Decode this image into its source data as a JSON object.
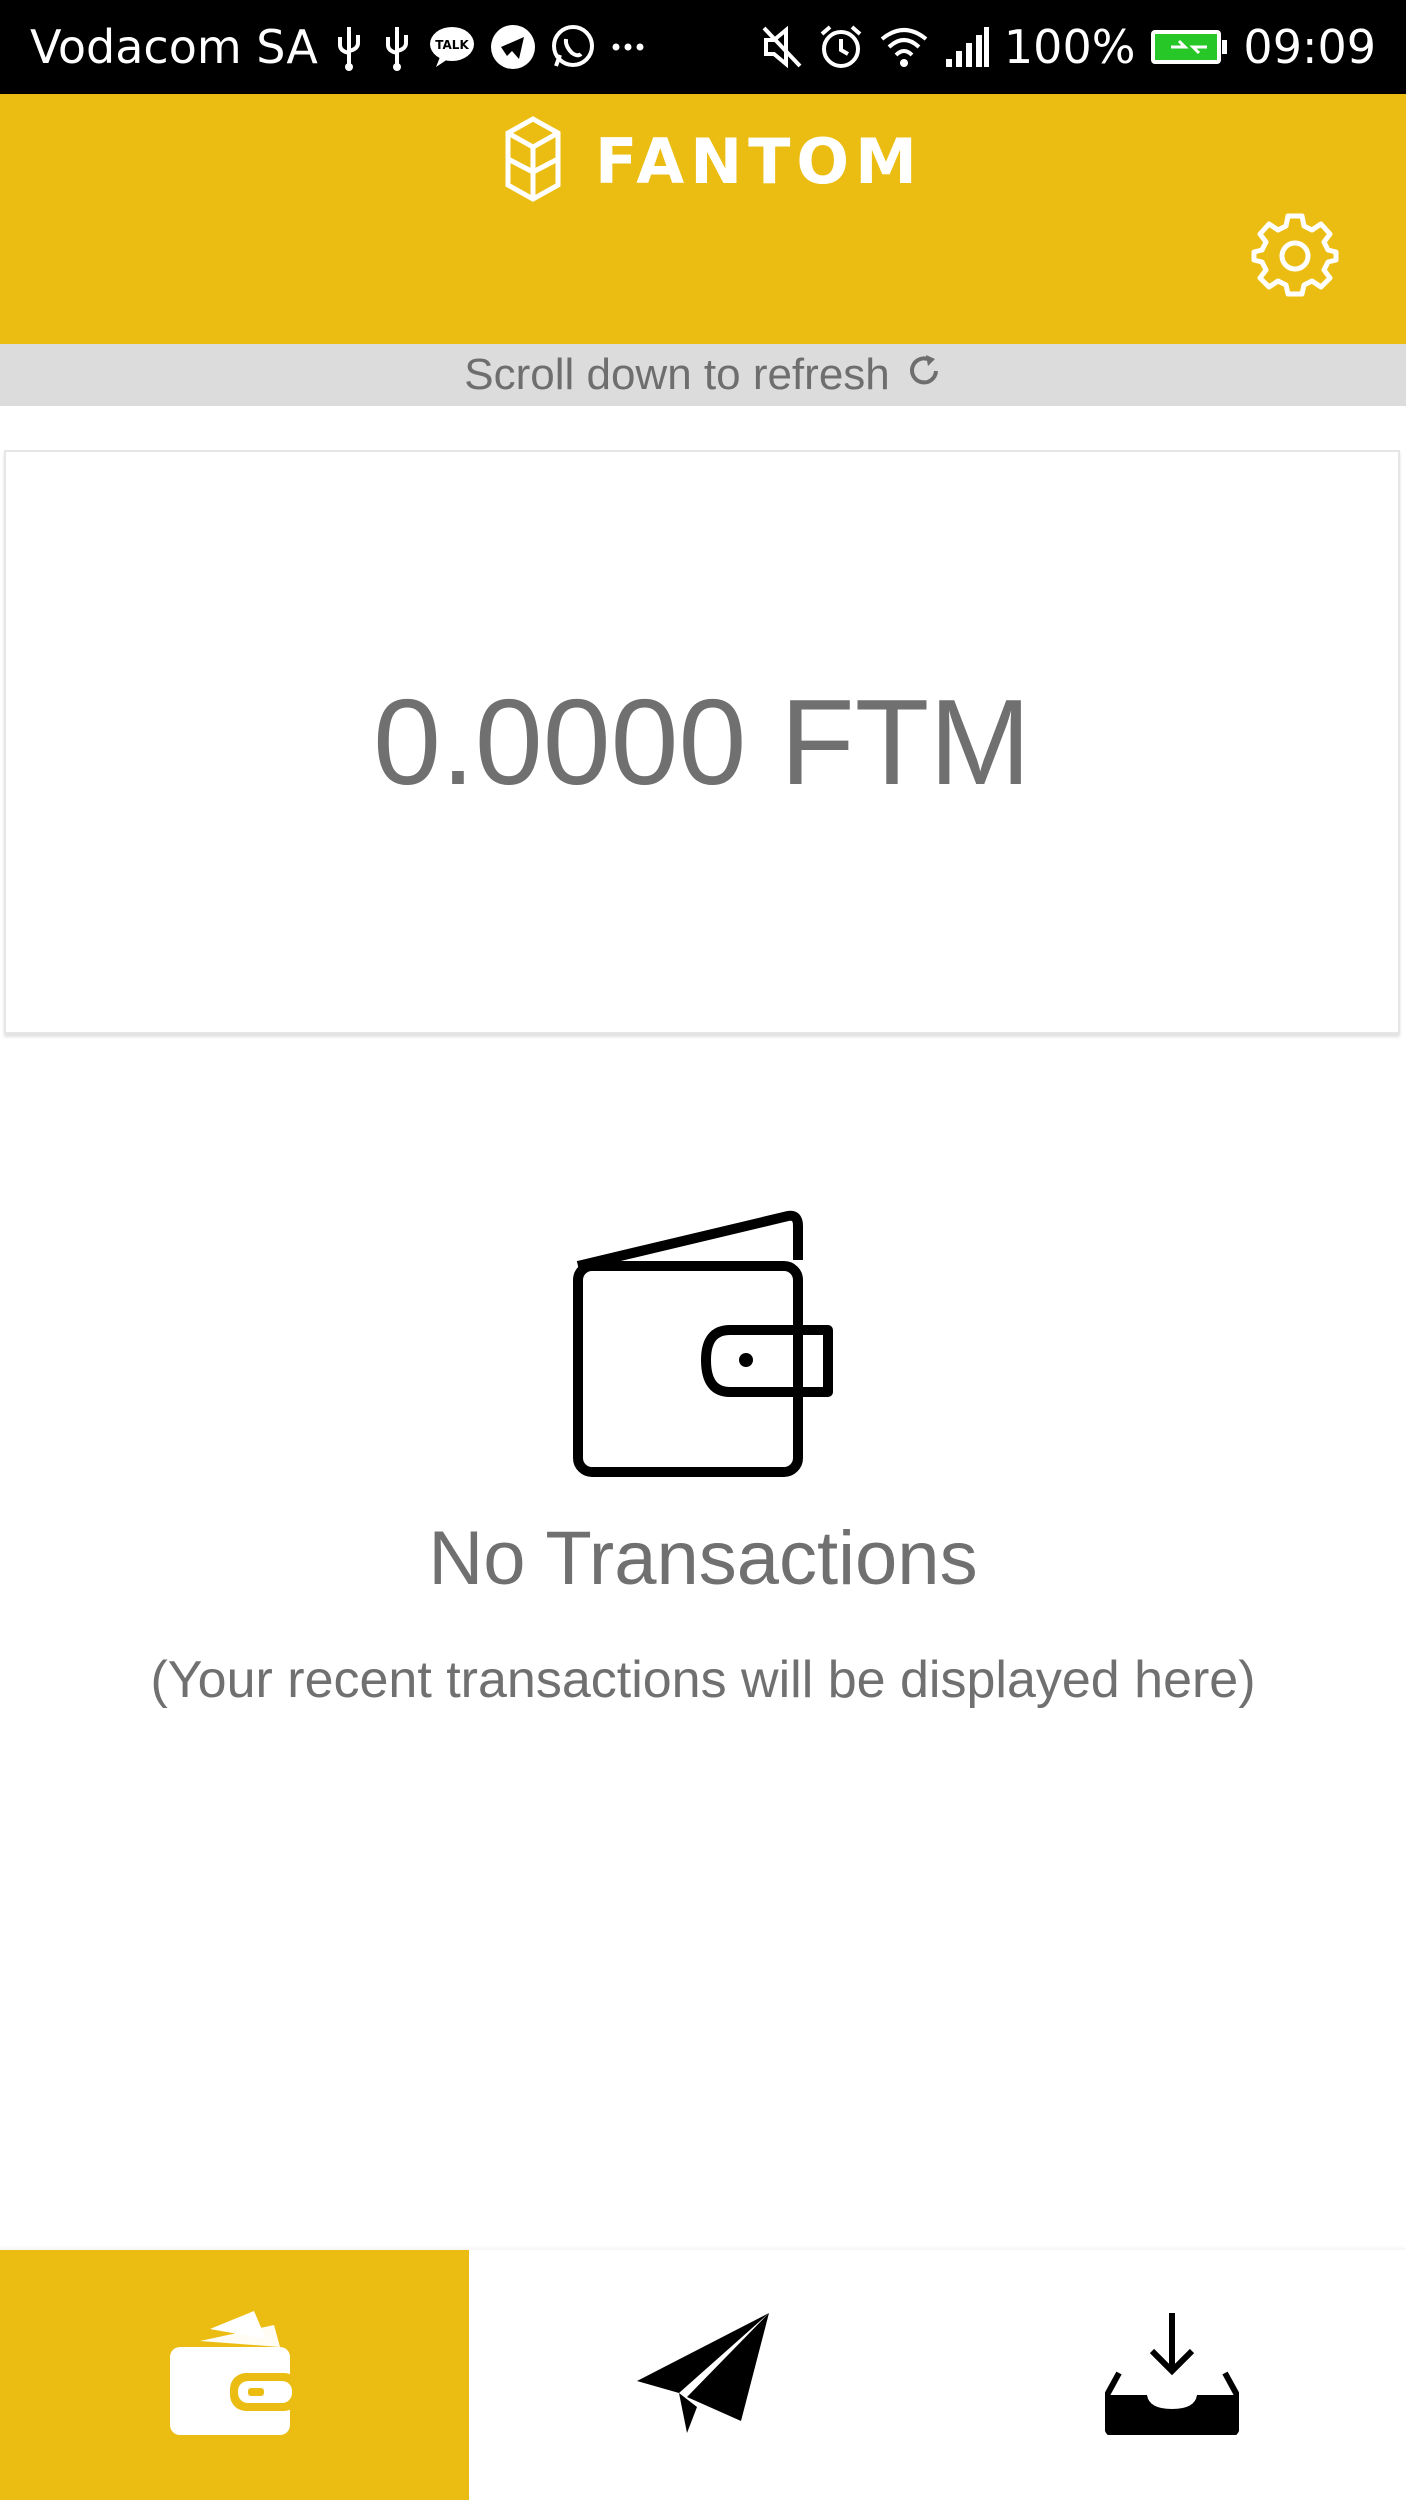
{
  "status_bar": {
    "carrier": "Vodacom SA",
    "battery": "100%",
    "time": "09:09"
  },
  "header": {
    "brand": "FANTOM",
    "settings_icon": "gear-icon",
    "color": "#ebbd13"
  },
  "refresh_hint": "Scroll down to refresh",
  "balance": {
    "amount": "0.0000 FTM"
  },
  "empty_state": {
    "icon": "wallet-icon",
    "title": "No Transactions",
    "subtitle": "(Your recent transactions will be displayed here)"
  },
  "bottom_nav": {
    "active": "wallet",
    "items": [
      {
        "id": "wallet",
        "icon": "wallet-icon"
      },
      {
        "id": "send",
        "icon": "paper-plane-icon"
      },
      {
        "id": "receive",
        "icon": "inbox-download-icon"
      }
    ]
  }
}
